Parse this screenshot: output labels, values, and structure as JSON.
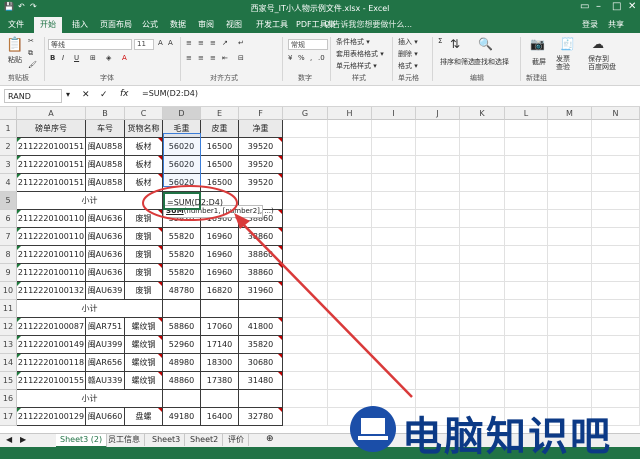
{
  "titlebar": {
    "title": "西家号_IT小人物示例文件.xlsx - Excel"
  },
  "tabs": [
    "文件",
    "开始",
    "插入",
    "页面布局",
    "公式",
    "数据",
    "审阅",
    "视图",
    "开发工具",
    "PDF工具集"
  ],
  "active_tab": 1,
  "tell_me": "♀ 告诉我您想要做什么...",
  "login": "登录",
  "share": "共享",
  "ribbon": {
    "clipboard": {
      "paste": "粘贴",
      "label": "剪贴板"
    },
    "font": {
      "name": "等线",
      "size": "11",
      "label": "字体"
    },
    "alignment": {
      "label": "对齐方式"
    },
    "number": {
      "format": "常规",
      "label": "数字"
    },
    "styles": {
      "conditional": "条件格式 ▾",
      "table": "套用表格格式 ▾",
      "cell": "单元格样式 ▾",
      "label": "样式"
    },
    "cells": {
      "insert": "插入 ▾",
      "delete": "删除 ▾",
      "format": "格式 ▾",
      "label": "单元格"
    },
    "editing": {
      "sort": "排序和筛选",
      "find": "查找和选择",
      "label": "编辑"
    },
    "new_group": {
      "screenshot": "截屏",
      "label": "新建组"
    },
    "baidu": {
      "save": "发票\n查验",
      "label": "保存到\n百度网盘"
    }
  },
  "formula_bar": {
    "name_box": "RAND",
    "formula": "=SUM(D2:D4)"
  },
  "columns": [
    "A",
    "B",
    "C",
    "D",
    "E",
    "F",
    "G",
    "H",
    "I",
    "J",
    "K",
    "L",
    "M",
    "N"
  ],
  "rows": [
    [
      "磅单序号",
      "车号",
      "货物名称",
      "毛重",
      "皮重",
      "净重"
    ],
    [
      "2112220100151",
      "闽AU858",
      "板材",
      "56020",
      "16500",
      "39520"
    ],
    [
      "2112220100151",
      "闽AU858",
      "板材",
      "56020",
      "16500",
      "39520"
    ],
    [
      "2112220100151",
      "闽AU858",
      "板材",
      "56020",
      "16500",
      "39520"
    ],
    [
      "小计",
      "",
      "",
      "=SUM(D2:D4)",
      "",
      ""
    ],
    [
      "2112220100110",
      "闽AU636",
      "废钢",
      "55820",
      "16960",
      "38860"
    ],
    [
      "2112220100110",
      "闽AU636",
      "废钢",
      "55820",
      "16960",
      "38860"
    ],
    [
      "2112220100110",
      "闽AU636",
      "废钢",
      "55820",
      "16960",
      "38860"
    ],
    [
      "2112220100110",
      "闽AU636",
      "废钢",
      "55820",
      "16960",
      "38860"
    ],
    [
      "2112220100132",
      "闽AU639",
      "废钢",
      "48780",
      "16820",
      "31960"
    ],
    [
      "小计",
      "",
      "",
      "",
      "",
      ""
    ],
    [
      "2112220100087",
      "闽AR751",
      "螺纹钢",
      "58860",
      "17060",
      "41800"
    ],
    [
      "2112220100149",
      "闽AU399",
      "螺纹钢",
      "52960",
      "17140",
      "35820"
    ],
    [
      "2112220100118",
      "闽AR656",
      "螺纹钢",
      "48980",
      "18300",
      "30680"
    ],
    [
      "2112220100155",
      "赣AU339",
      "螺纹钢",
      "48860",
      "17380",
      "31480"
    ],
    [
      "小计",
      "",
      "",
      "",
      "",
      ""
    ],
    [
      "2112220100129",
      "闽AU660",
      "盘螺",
      "49180",
      "16400",
      "32780"
    ]
  ],
  "tooltip": {
    "fn": "SUM",
    "args": "(number1, [number2], ...)"
  },
  "sheets": [
    "Sheet3 (2)",
    "员工信息",
    "Sheet3",
    "Sheet2",
    "评价"
  ],
  "active_sheet": 0,
  "watermark": {
    "text": "电脑知识吧"
  },
  "colors": {
    "excel_green": "#217346",
    "arrow_red": "#d93a3a",
    "watermark_blue": "#0c3a86"
  }
}
